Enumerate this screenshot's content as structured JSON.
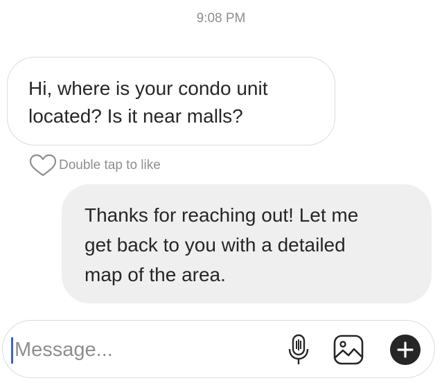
{
  "timestamp": "9:08 PM",
  "incoming": {
    "line1": "Hi, where is your condo unit",
    "line2": "located? Is it near malls?"
  },
  "like_hint": "Double tap to like",
  "outgoing": {
    "line1": "Thanks for reaching out! Let me",
    "line2": "get back to you with a detailed",
    "line3": "map of the area."
  },
  "composer": {
    "placeholder": "Message...",
    "icons": [
      "microphone-icon",
      "image-icon",
      "plus-icon"
    ]
  },
  "colors": {
    "caret": "#3b5fd6",
    "outgoing_bubble": "#efefef",
    "border": "#dbdbdb",
    "muted_text": "#8e8e8e"
  }
}
